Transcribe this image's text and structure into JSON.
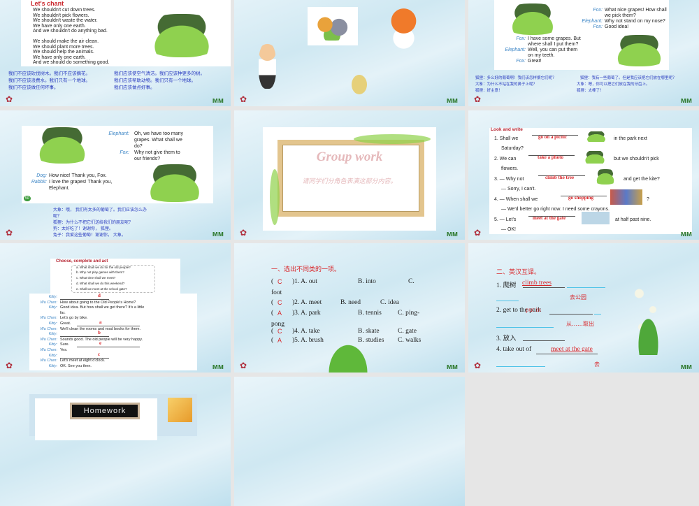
{
  "slides": [
    {
      "title": "Let's chant",
      "lines": [
        "We shouldn't cut down trees.",
        "We shouldn't pick flowers.",
        "We shouldn't waste the water.",
        "We have only one earth.",
        "And we shouldn't do anything bad.",
        "We should make the air clean.",
        "We should plant more trees.",
        "We should help the animals.",
        "We have only one earth.",
        "And we should do something good."
      ],
      "cn_left": [
        "我们不应该砍伐树木。我们不应该摘花。",
        "我们不应该浪费水。我们只有一个地球。",
        "我们不应该做任何坏事。"
      ],
      "cn_right": [
        "我们应该使空气清洁。我们应该种更多的树。",
        "我们应该帮助动物。我们只有一个地球。",
        "我们应该做点好事。"
      ]
    },
    {
      "title": "Animals and fox"
    },
    {
      "dialog1": [
        [
          "Fox:",
          "What nice grapes! How shall"
        ],
        [
          "",
          "we pick them?"
        ],
        [
          "Elephant:",
          "Why not stand on my nose?"
        ],
        [
          "Fox:",
          "Good idea!"
        ]
      ],
      "dialog2": [
        [
          "Fox:",
          "I have some grapes. But"
        ],
        [
          "",
          "where shall I put them?"
        ],
        [
          "Elephant:",
          "Well, you can put them"
        ],
        [
          "",
          "on my teeth."
        ],
        [
          "Fox:",
          "Great!"
        ]
      ],
      "cn": [
        "狐狸：多么好的葡萄啊！我们该怎样摘它们呢？",
        "大象：为什么不站在我的鼻子上呢？",
        "狐狸：好主意！",
        "狐狸：我有一些葡萄了。但是我应该把它们放在哪里呢？",
        "大象：嗯，你可以把它们放在我的牙齿上。",
        "狐狸：太棒了！"
      ]
    },
    {
      "dialog1": [
        [
          "Elephant:",
          "Oh, we have too many"
        ],
        [
          "",
          "grapes. What shall we"
        ],
        [
          "",
          "do?"
        ],
        [
          "Fox:",
          "Why not give them to"
        ],
        [
          "",
          "our friends?"
        ]
      ],
      "dialog2": [
        [
          "Dog:",
          "How nice! Thank you, Fox."
        ],
        [
          "Rabbit:",
          "I love the grapes! Thank you,"
        ],
        [
          "",
          "Elephant."
        ]
      ],
      "page": "50",
      "cn": [
        "大象：哦， 我们有太多的葡萄了。我们应该怎么办",
        "呢？",
        "狐狸：为什么不把它们送给我们的朋友呢？",
        "   狗：太好吃了！谢谢你， 狐狸。",
        "兔子：我爱这些葡萄！谢谢你， 大象。"
      ]
    },
    {
      "title": "Group work",
      "subtitle": "请同学们分角色表演这部分内容。"
    },
    {
      "title": "Look and write",
      "items": [
        {
          "pre": "1. Shall we",
          "ans": "go on a picnic",
          "post": "in the park next",
          "cont": "Saturday?"
        },
        {
          "pre": "2. We can",
          "ans": "take a photo",
          "post": "but we shouldn't pick",
          "cont": "flowers."
        },
        {
          "pre": "3. — Why not",
          "ans": "climb the tree",
          "post": "and get the kite?",
          "cont": "— Sorry, I can't."
        },
        {
          "pre": "4. — When shall we",
          "ans": "go shopping",
          "post": "?",
          "cont": "— We'd better go right now. I need some crayons."
        },
        {
          "pre": "5. — Let's",
          "ans": "meet at the gate",
          "post": "at half past nine.",
          "cont": "— OK!"
        }
      ]
    },
    {
      "title": "Choose, complete and act",
      "options": [
        "a. What shall we do for the old people?",
        "b. Why not play games with them?",
        "c. What time shall we meet?",
        "d. What shall we do this weekend?",
        "e. Shall we meet at the school gate?"
      ],
      "dialog": [
        [
          "Kitty:",
          "",
          "d"
        ],
        [
          "Wu Chen:",
          "How about going to the Old People's Home?",
          ""
        ],
        [
          "Kitty:",
          "Good idea. But how shall we get there? It's a little",
          ""
        ],
        [
          "",
          "far.",
          ""
        ],
        [
          "Wu Chen:",
          "Let's go by bike.",
          ""
        ],
        [
          "Kitty:",
          "Great.",
          "a"
        ],
        [
          "Wu Chen:",
          "We'll clean the rooms and read books for them.",
          ""
        ],
        [
          "Kitty:",
          "",
          "b"
        ],
        [
          "Wu Chen:",
          "Sounds good. The old people will be very happy.",
          ""
        ],
        [
          "Kitty:",
          "Sure.",
          "e"
        ],
        [
          "Wu Chen:",
          "Yes.",
          ""
        ],
        [
          "Kitty:",
          "",
          "c"
        ],
        [
          "Wu Chen:",
          "Let's meet at eight o'clock.",
          ""
        ],
        [
          "Kitty:",
          "OK. See you then.",
          ""
        ]
      ]
    },
    {
      "title": "一、选出不同类的一项。",
      "rows": [
        {
          "ans": "C",
          "text": ")1. A. out",
          "b": "B. into",
          "c": "C.",
          "wrap": "foot"
        },
        {
          "ans": "C",
          "text": ")2. A. meet",
          "b": "B. need",
          "c": "C. idea",
          "wrap": ""
        },
        {
          "ans": "A",
          "text": ")3. A. park",
          "b": "B. tennis",
          "c": "C. ping-",
          "wrap": "pong"
        },
        {
          "ans": "C",
          "text": ")4. A. take",
          "b": "B. skate",
          "c": "C. gate",
          "wrap": ""
        },
        {
          "ans": "A",
          "text": ")5. A. brush",
          "b": "B. studies",
          "c": "C. walks",
          "wrap": ""
        }
      ],
      "paren": "("
    },
    {
      "title": "二、英汉互译。",
      "q": [
        "1. 爬树",
        "2. get to the park",
        "3. 放入",
        "4. take out of"
      ],
      "a": [
        "climb trees",
        "去公园",
        "put in",
        "从……取出",
        "meet at the gate",
        "去"
      ]
    },
    {
      "title": "Homework"
    },
    {
      "title": ""
    }
  ]
}
